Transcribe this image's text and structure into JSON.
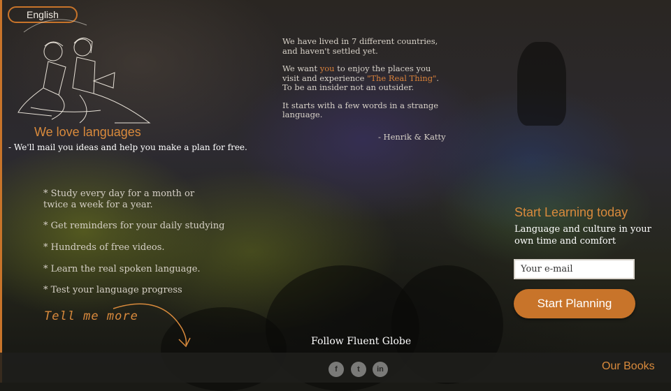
{
  "header": {
    "language_button": "English"
  },
  "intro": {
    "heading": "We love languages",
    "tagline": "- We'll mail you ideas and help you make a plan for free."
  },
  "quote": {
    "p1": "We have lived in 7 different countries, and haven't settled yet.",
    "p2_before": "We want ",
    "p2_you": "you",
    "p2_middle": " to enjoy the places you visit and experience ",
    "p2_real": "\"The Real Thing\"",
    "p2_after": ". To be an insider not an outsider.",
    "p3": "It starts with a few words in a strange language.",
    "signature": "- Henrik & Katty"
  },
  "features": [
    "* Study every day for a month or twice a week for a year.",
    "* Get reminders for your daily studying",
    "* Hundreds of free videos.",
    "* Learn the real spoken language.",
    "* Test your language progress"
  ],
  "tell_more": "Tell me more",
  "signup": {
    "title": "Start Learning today",
    "subtitle": "Language and culture in your own time and comfort",
    "email_placeholder": "Your e-mail",
    "button": "Start Planning"
  },
  "footer": {
    "follow": "Follow Fluent Globe",
    "social": [
      {
        "icon": "facebook-icon",
        "glyph": "f"
      },
      {
        "icon": "twitter-icon",
        "glyph": "t"
      },
      {
        "icon": "linkedin-icon",
        "glyph": "in"
      }
    ],
    "books": "Our Books"
  },
  "colors": {
    "accent": "#c8742a",
    "accent_text": "#d98a3c"
  }
}
